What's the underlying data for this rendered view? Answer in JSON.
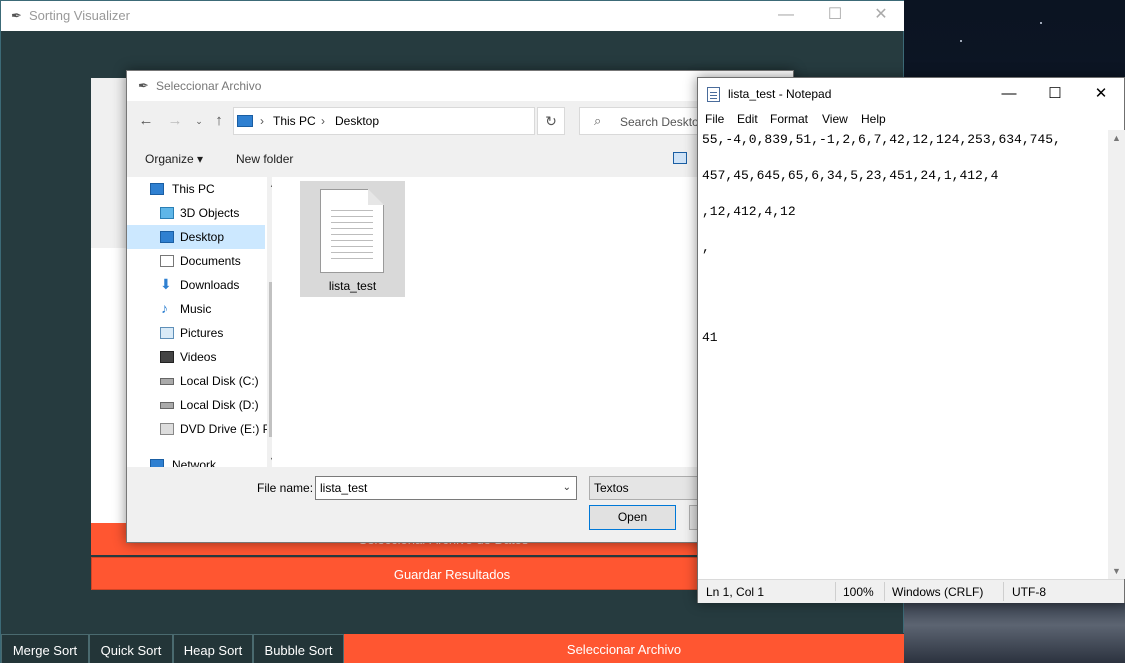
{
  "main_window": {
    "title": "Sorting Visualizer",
    "feather_icon": "feather-icon",
    "save_results_label": "Guardar Resultados",
    "hidden_strip_label": "Seleccionar Archivo de Datos",
    "bottom_buttons": [
      "Merge Sort",
      "Quick Sort",
      "Heap Sort",
      "Bubble Sort"
    ],
    "select_file_label": "Seleccionar Archivo",
    "accent_color": "#ff5631",
    "bg_color": "#263b3f"
  },
  "file_dialog": {
    "title": "Seleccionar Archivo",
    "breadcrumb": [
      "This PC",
      "Desktop"
    ],
    "search_placeholder": "Search Desktop",
    "organize_label": "Organize ▾",
    "new_folder_label": "New folder",
    "nav_items": [
      {
        "label": "This PC",
        "icon": "computer-icon"
      },
      {
        "label": "3D Objects",
        "icon": "cube-icon"
      },
      {
        "label": "Desktop",
        "icon": "desktop-icon",
        "selected": true
      },
      {
        "label": "Documents",
        "icon": "documents-icon"
      },
      {
        "label": "Downloads",
        "icon": "download-arrow-icon"
      },
      {
        "label": "Music",
        "icon": "music-note-icon"
      },
      {
        "label": "Pictures",
        "icon": "pictures-icon"
      },
      {
        "label": "Videos",
        "icon": "film-icon"
      },
      {
        "label": "Local Disk (C:)",
        "icon": "disk-icon"
      },
      {
        "label": "Local Disk (D:)",
        "icon": "disk-icon"
      },
      {
        "label": "DVD Drive (E:) PF",
        "icon": "dvd-icon"
      },
      {
        "label": "Network",
        "icon": "network-icon"
      }
    ],
    "file": {
      "name": "lista_test"
    },
    "file_name_label": "File name:",
    "file_name_value": "lista_test",
    "file_type_value": "Textos",
    "open_label": "Open"
  },
  "notepad": {
    "title": "lista_test - Notepad",
    "menu": [
      "File",
      "Edit",
      "Format",
      "View",
      "Help"
    ],
    "lines": [
      "55,-4,0,839,51,-1,2,6,7,42,12,124,253,634,745,",
      "",
      "457,45,645,65,6,34,5,23,451,24,1,412,4",
      "",
      ",12,412,4,12",
      "",
      ",",
      "",
      "",
      "",
      "",
      "41"
    ],
    "status": {
      "position": "Ln 1, Col 1",
      "zoom": "100%",
      "line_endings": "Windows (CRLF)",
      "encoding": "UTF-8"
    }
  }
}
